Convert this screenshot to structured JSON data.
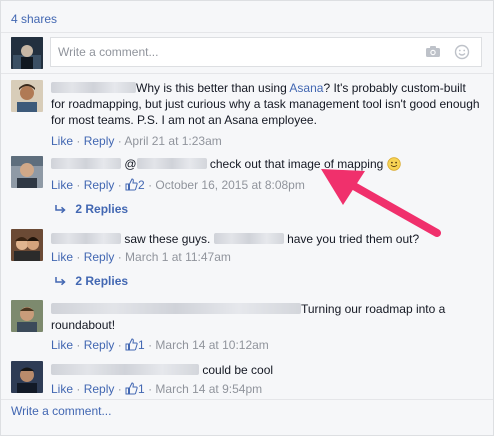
{
  "shares": "4 shares",
  "composer": {
    "placeholder": "Write a comment...",
    "camera_icon": "camera-icon",
    "emoji_icon": "smiley-icon"
  },
  "comments": [
    {
      "text": "Why is this better than using ",
      "link": "Asana",
      "text2": "? It's probably custom-built for roadmapping, but just curious why a task management tool isn't good enough for most teams. P.S. I am not an Asana employee.",
      "like": "Like",
      "reply": "Reply",
      "time": "April 21 at 1:23am"
    },
    {
      "at": "@",
      "text": "check out that image of mapping",
      "like": "Like",
      "reply": "Reply",
      "likes": "2",
      "time": "October 16, 2015 at 8:08pm",
      "replies": "2 Replies"
    },
    {
      "text": "saw these guys.",
      "text2": "have you tried them out?",
      "like": "Like",
      "reply": "Reply",
      "time": "March 1 at 11:47am",
      "replies": "2 Replies"
    },
    {
      "text": "Turning our roadmap into a roundabout!",
      "like": "Like",
      "reply": "Reply",
      "likes": "1",
      "time": "March 14 at 10:12am"
    },
    {
      "text": "could be cool",
      "like": "Like",
      "reply": "Reply",
      "likes": "1",
      "time": "March 14 at 9:54pm"
    }
  ],
  "write_comment": "Write a comment...",
  "arrow_color": "#f0306c",
  "link_color": "#4267b2"
}
